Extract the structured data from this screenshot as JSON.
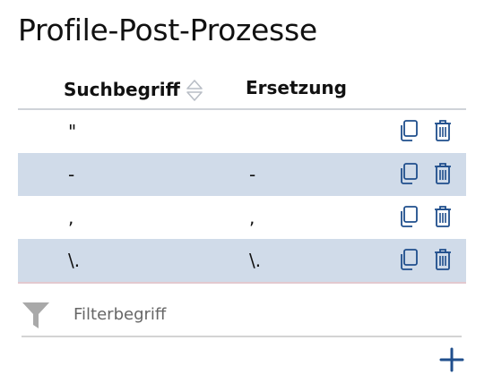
{
  "page": {
    "title": "Profile-Post-Prozesse"
  },
  "table": {
    "columns": {
      "search": "Suchbegriff",
      "replacement": "Ersetzung"
    },
    "rows": [
      {
        "search": "\"",
        "replacement": ""
      },
      {
        "search": "-",
        "replacement": "-"
      },
      {
        "search": ",",
        "replacement": ","
      },
      {
        "search": "\\.",
        "replacement": "\\."
      }
    ]
  },
  "filter": {
    "placeholder": "Filterbegriff",
    "value": ""
  },
  "icons": {
    "sort": "sort-icon",
    "copy": "copy-icon",
    "delete": "trash-icon",
    "filter": "filter-icon",
    "add": "plus-icon"
  },
  "colors": {
    "accent": "#1f4e8c",
    "row_alt": "#d0dbe9",
    "sort_icon": "#b9bec6",
    "filter_icon": "#a9a9a9"
  }
}
